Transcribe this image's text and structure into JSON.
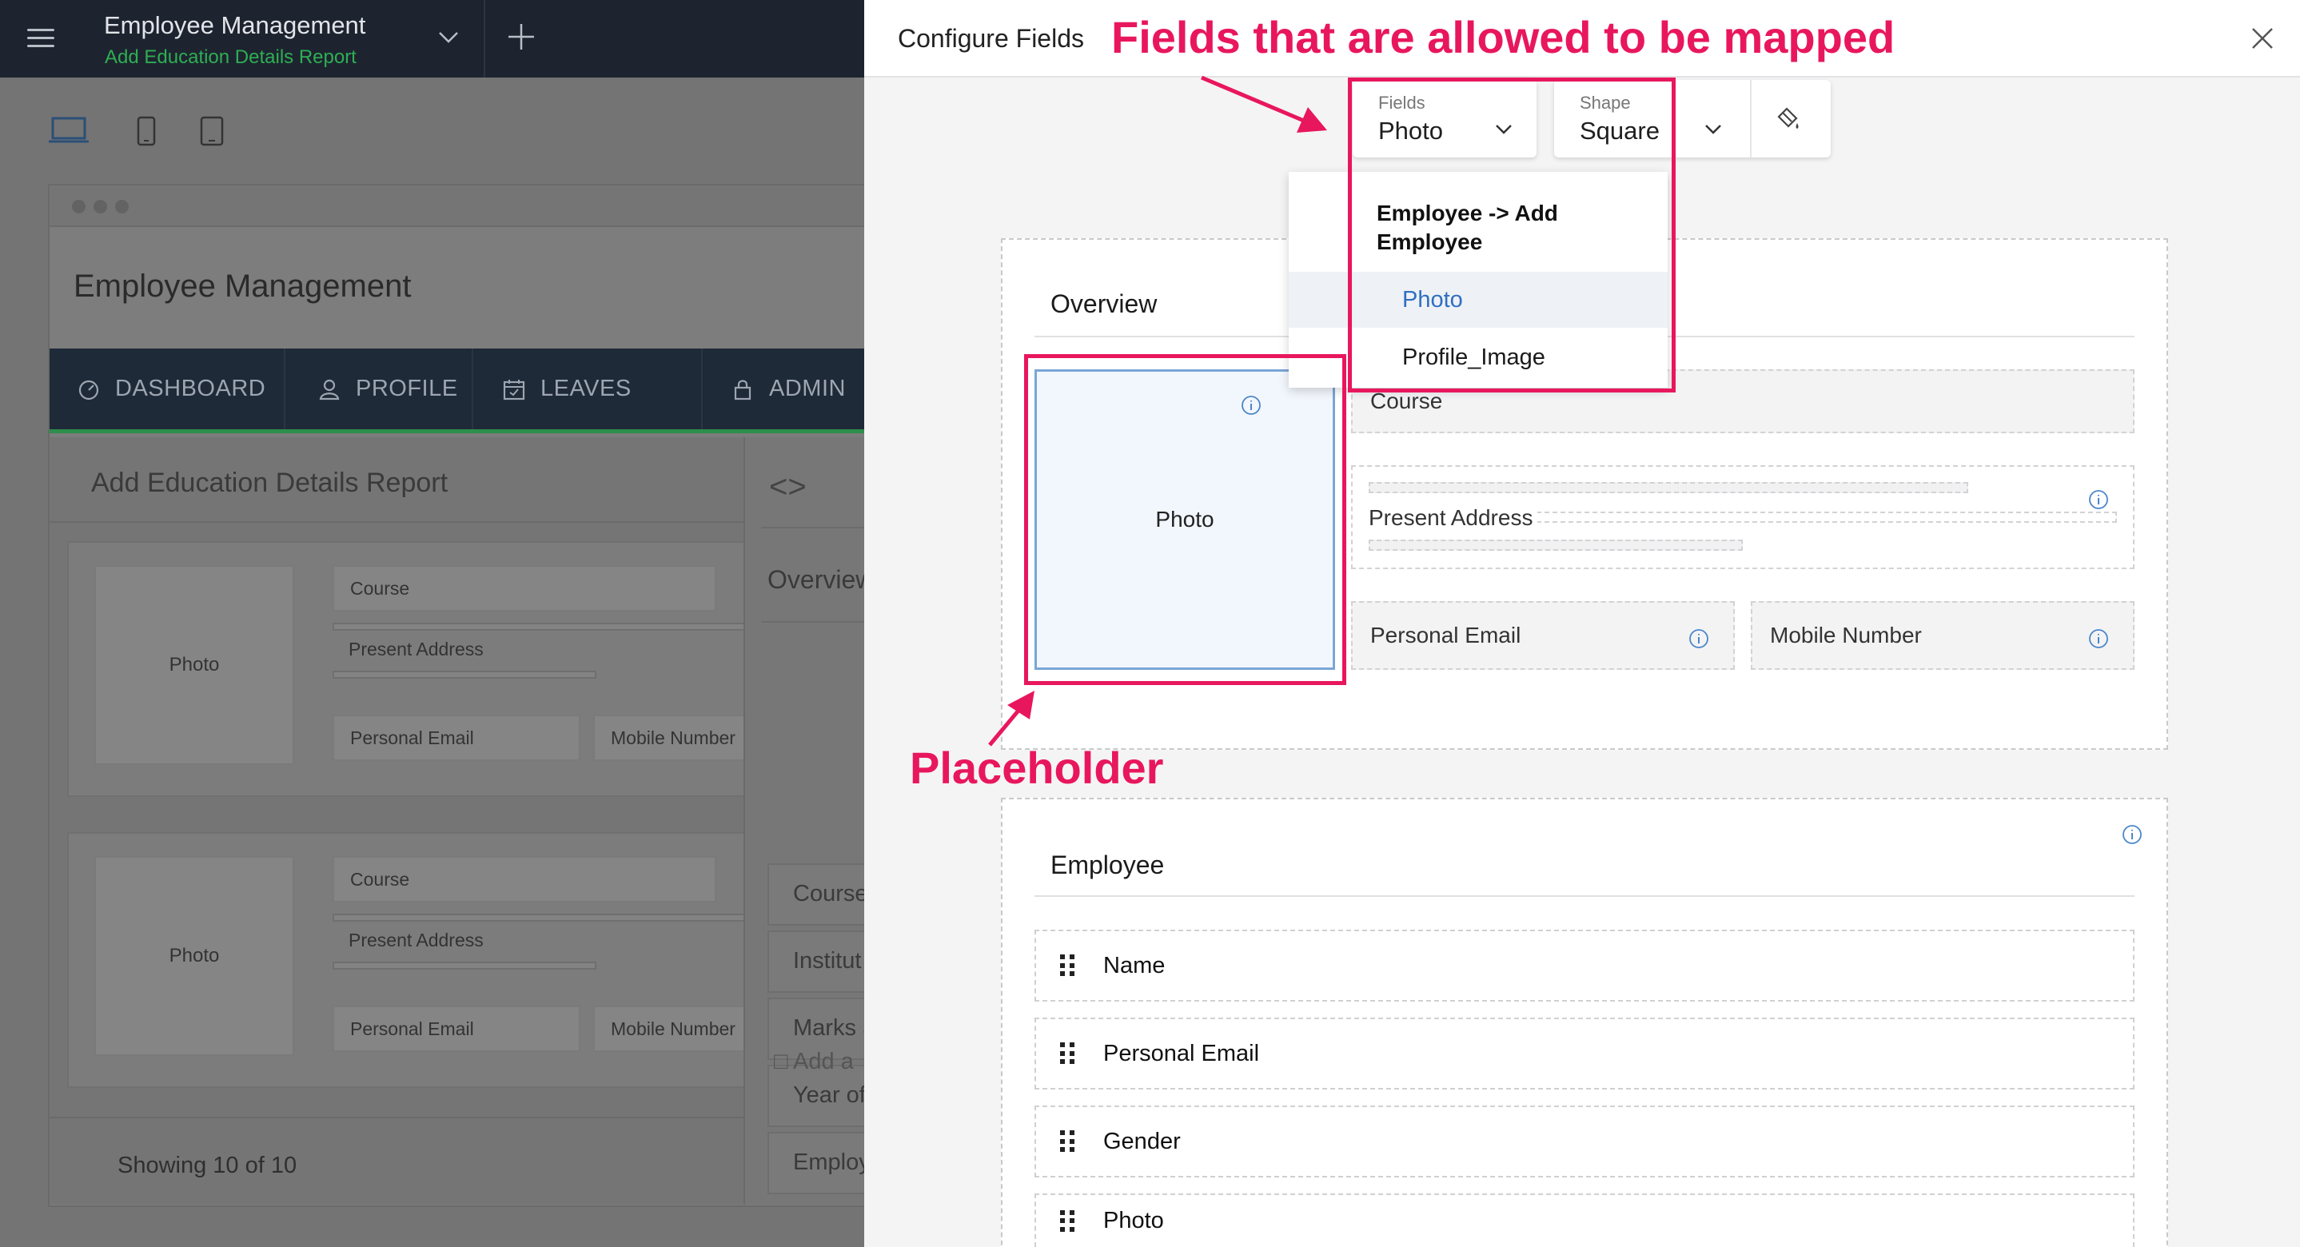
{
  "left_app": {
    "title": "Employee Management",
    "subtitle": "Add Education Details Report",
    "window_title": "Employee Management",
    "nav": [
      "DASHBOARD",
      "PROFILE",
      "LEAVES",
      "ADMIN"
    ],
    "report_title": "Add Education Details Report",
    "cards": [
      {
        "photo": "Photo",
        "course": "Course",
        "address": "Present Address",
        "email": "Personal Email",
        "mobile": "Mobile Number"
      },
      {
        "photo": "Photo",
        "course": "Course",
        "address": "Present Address",
        "email": "Personal Email",
        "mobile": "Mobile Number"
      }
    ],
    "showing": "Showing 10 of 10",
    "side_overview": "Overview",
    "side_items": [
      "Course",
      "Institut",
      "Marks S",
      "Year of",
      "Employ"
    ],
    "side_add": "Add a"
  },
  "panel": {
    "title": "Configure Fields",
    "fields_caption": "Fields",
    "fields_value": "Photo",
    "shape_caption": "Shape",
    "shape_value": "Square",
    "dropdown": {
      "group": "Employee -> Add Employee",
      "options": [
        "Photo",
        "Profile_Image"
      ],
      "selected": "Photo"
    },
    "overview": {
      "title": "Overview",
      "photo": "Photo",
      "course": "Course",
      "present_address": "Present Address",
      "personal_email": "Personal Email",
      "mobile_number": "Mobile Number"
    },
    "employee": {
      "title": "Employee",
      "rows": [
        "Name",
        "Personal Email",
        "Gender",
        "Photo"
      ]
    }
  },
  "annotations": {
    "top": "Fields that are allowed to be mapped",
    "placeholder": "Placeholder",
    "color": "#e8175d"
  }
}
